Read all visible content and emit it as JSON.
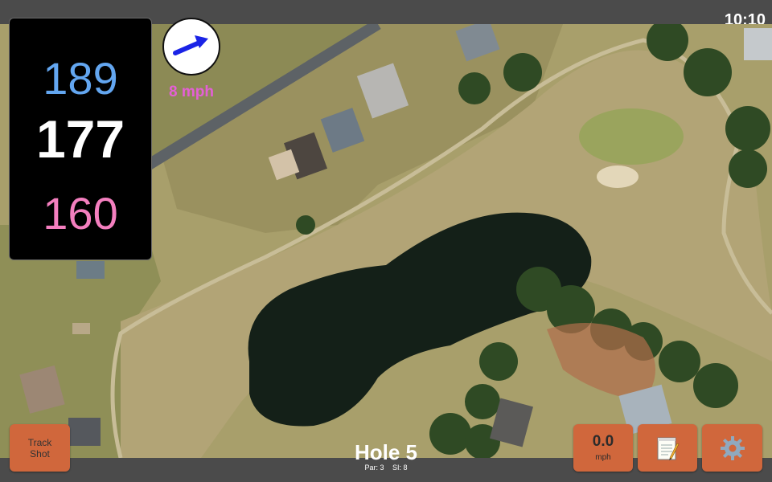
{
  "status_bar": {
    "time": "10:10"
  },
  "distances": {
    "back": "189",
    "middle": "177",
    "front": "160"
  },
  "wind": {
    "speed_label": "8 mph",
    "arrow_icon": "wind-direction-arrow-icon"
  },
  "hole": {
    "title": "Hole 5",
    "par": "Par: 3",
    "si": "SI: 8"
  },
  "buttons": {
    "track_shot_line1": "Track",
    "track_shot_line2": "Shot",
    "speed_value": "0.0",
    "speed_unit": "mph",
    "notes_icon": "notepad-icon",
    "settings_icon": "gear-icon"
  },
  "colors": {
    "back_distance": "#63a6f0",
    "middle_distance": "#ffffff",
    "front_distance": "#f47fbf",
    "wind_text": "#e45fd6",
    "button": "#d0673c"
  }
}
